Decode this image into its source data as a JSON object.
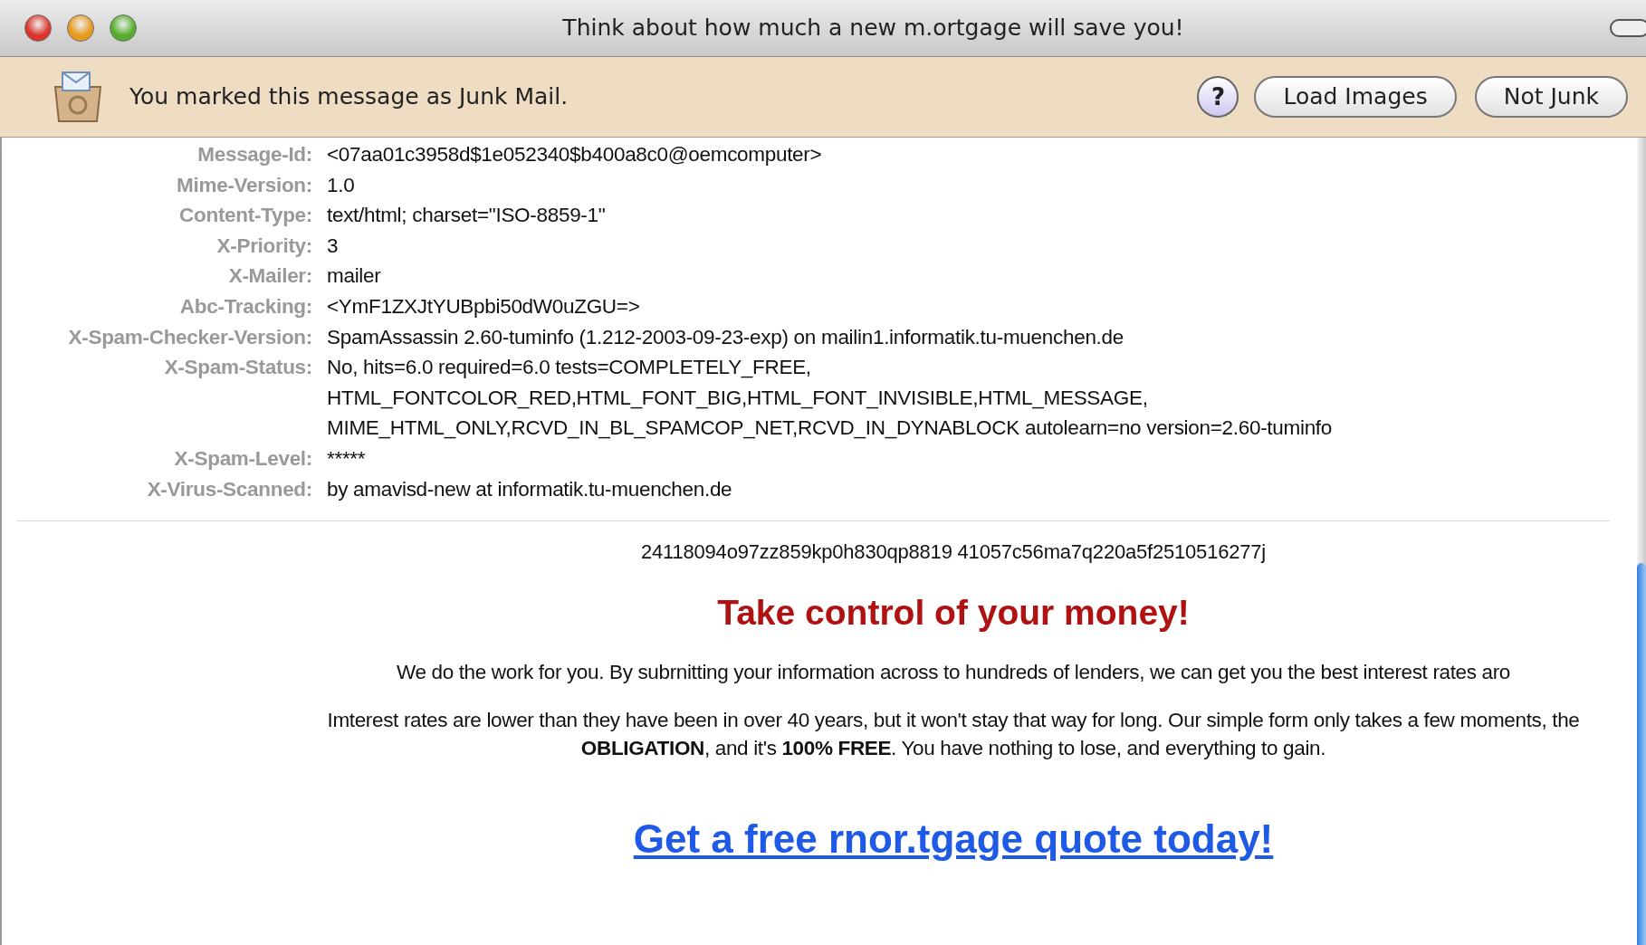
{
  "window": {
    "title": "Think about how much a new m.ortgage will save you!"
  },
  "junk_bar": {
    "message": "You marked this message as Junk Mail.",
    "help_button": "?",
    "buttons": [
      "Load Images",
      "Not Junk"
    ]
  },
  "headers": [
    {
      "name": "Message-Id:",
      "lines": [
        "<07aa01c3958d$1e052340$b400a8c0@oemcomputer>"
      ]
    },
    {
      "name": "Mime-Version:",
      "lines": [
        "1.0"
      ]
    },
    {
      "name": "Content-Type:",
      "lines": [
        "text/html; charset=\"ISO-8859-1\""
      ]
    },
    {
      "name": "X-Priority:",
      "lines": [
        "3"
      ]
    },
    {
      "name": "X-Mailer:",
      "lines": [
        "mailer"
      ]
    },
    {
      "name": "Abc-Tracking:",
      "lines": [
        "<YmF1ZXJtYUBpbi50dW0uZGU=>"
      ]
    },
    {
      "name": "X-Spam-Checker-Version:",
      "lines": [
        "SpamAssassin 2.60-tuminfo (1.212-2003-09-23-exp) on  mailin1.informatik.tu-muenchen.de"
      ]
    },
    {
      "name": "X-Spam-Status:",
      "lines": [
        "No, hits=6.0 required=6.0 tests=COMPLETELY_FREE,",
        "HTML_FONTCOLOR_RED,HTML_FONT_BIG,HTML_FONT_INVISIBLE,HTML_MESSAGE,",
        "MIME_HTML_ONLY,RCVD_IN_BL_SPAMCOP_NET,RCVD_IN_DYNABLOCK autolearn=no  version=2.60-tuminfo"
      ]
    },
    {
      "name": "X-Spam-Level:",
      "lines": [
        "*****"
      ]
    },
    {
      "name": "X-Virus-Scanned:",
      "lines": [
        "by amavisd-new at informatik.tu-muenchen.de"
      ]
    }
  ],
  "body": {
    "code": "24118094o97zz859kp0h830qp8819 41057c56ma7q220a5f2510516277j",
    "headline": "Take control of your money!",
    "paragraphs": [
      [
        "We do the work for you. By subrnitting your information across to hundreds of lenders, we can get you the best interest rates aro"
      ],
      [
        "Imterest rates are lower than they have been in over 40 years, but it won't stay that way for long. Our simple form only takes a few moments, the",
        "**OBLIGATION**, and it's **100% FREE**. You have nothing to lose, and everything to gain."
      ]
    ],
    "link": "Get a free rnor.tgage quote today!"
  }
}
